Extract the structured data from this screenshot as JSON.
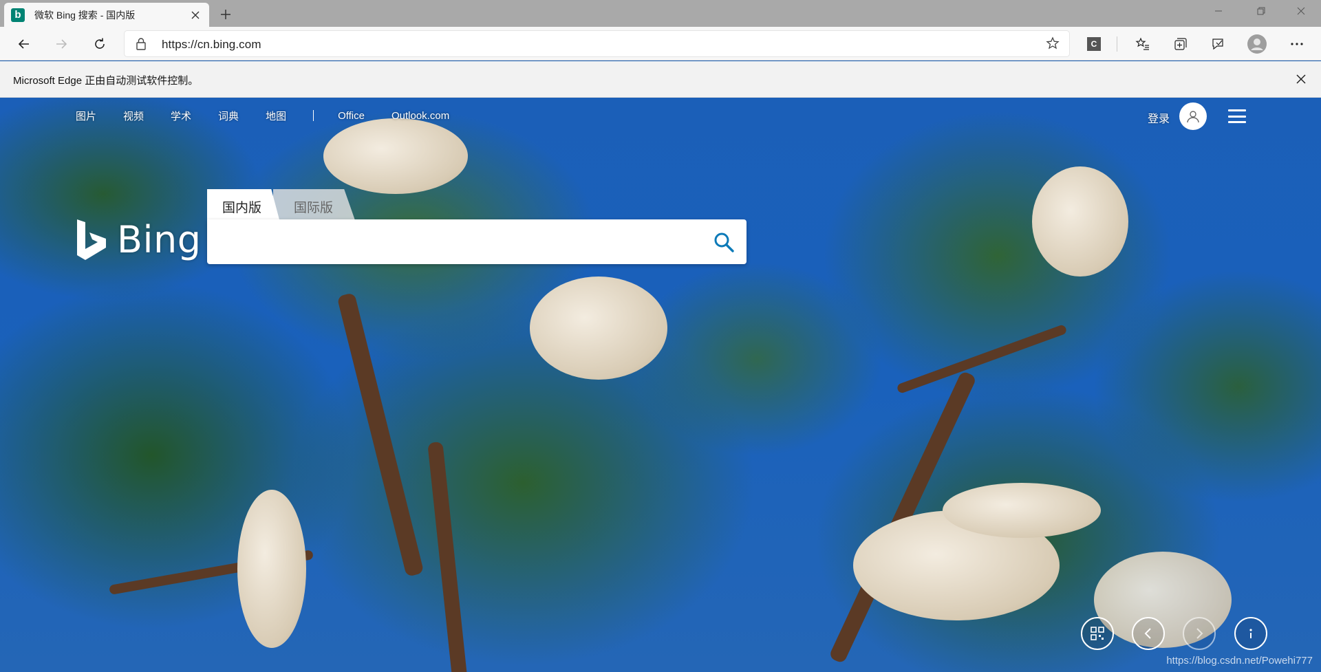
{
  "browser": {
    "tab": {
      "favicon": "bing-favicon",
      "title": "微软 Bing 搜索 - 国内版"
    },
    "url": "https://cn.bing.com",
    "extension_badge": "C",
    "infobar": {
      "text": "Microsoft Edge 正由自动测试软件控制。"
    },
    "icons": [
      "back-icon",
      "forward-icon",
      "refresh-icon",
      "lock-icon",
      "star-icon",
      "favorites-icon",
      "collections-icon",
      "feedback-icon",
      "profile-icon",
      "more-icon"
    ]
  },
  "bing": {
    "nav": [
      "图片",
      "视频",
      "学术",
      "词典",
      "地图",
      "Office",
      "Outlook.com"
    ],
    "signin_label": "登录",
    "logo_text": "Bing",
    "scope_tabs": [
      "国内版",
      "国际版"
    ],
    "search": {
      "placeholder": "",
      "value": ""
    },
    "bottom_buttons": [
      "qr-code-icon",
      "previous-icon",
      "next-icon",
      "info-icon"
    ],
    "watermark": "https://blog.csdn.net/Powehi777"
  },
  "colors": {
    "bing_teal": "#008373",
    "sky_blue": "#1a61bb",
    "search_icon": "#0c7ab8"
  }
}
